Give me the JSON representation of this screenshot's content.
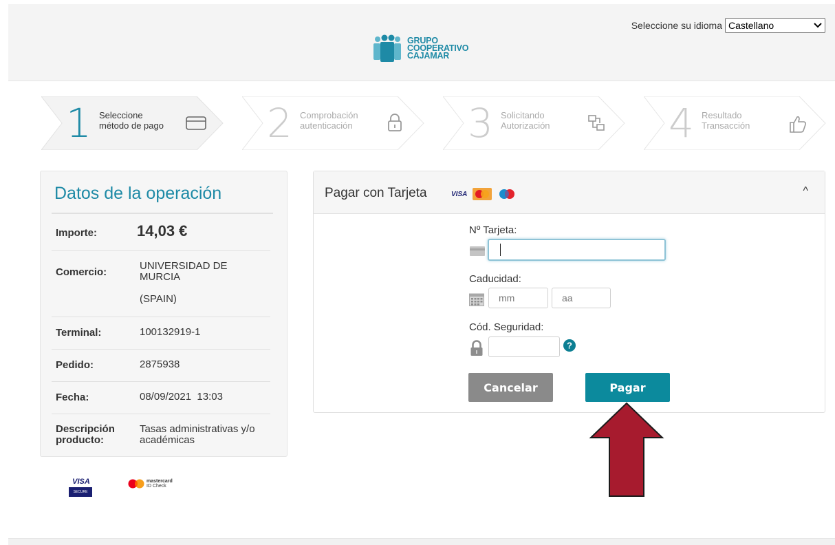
{
  "header": {
    "logo_lines": [
      "GRUPO",
      "COOPERATIVO",
      "CAJAMAR"
    ],
    "language_label": "Seleccione su idioma",
    "language_selected": "Castellano"
  },
  "steps": [
    {
      "number": "1",
      "line1": "Seleccione",
      "line2": "método de pago",
      "icon": "credit-card-icon",
      "state": "active"
    },
    {
      "number": "2",
      "line1": "Comprobación",
      "line2": "autenticación",
      "icon": "lock-icon",
      "state": "inactive"
    },
    {
      "number": "3",
      "line1": "Solicitando",
      "line2": "Autorización",
      "icon": "authorization-icon",
      "state": "inactive"
    },
    {
      "number": "4",
      "line1": "Resultado",
      "line2": "Transacción",
      "icon": "thumbs-up-icon",
      "state": "inactive"
    }
  ],
  "operation": {
    "title": "Datos de la operación",
    "amount_label": "Importe:",
    "amount_value": "14,03 €",
    "merchant_label": "Comercio:",
    "merchant_line1": "UNIVERSIDAD DE",
    "merchant_line2": "MURCIA",
    "merchant_line3": "(SPAIN)",
    "terminal_label": "Terminal:",
    "terminal_value": "100132919-1",
    "order_label": "Pedido:",
    "order_value": "2875938",
    "date_label": "Fecha:",
    "date_value": "08/09/2021  13:03",
    "desc_label_1": "Descripción",
    "desc_label_2": "producto:",
    "desc_value_1": "Tasas administrativas y/o",
    "desc_value_2": "académicas"
  },
  "badges": {
    "visa_text": "VISA",
    "visa_sub": "SECURE",
    "mc_line1": "mastercard",
    "mc_line2": "ID Check"
  },
  "card": {
    "title": "Pagar con Tarjeta",
    "visa_logo": "VISA",
    "collapse_glyph": "^",
    "card_number_label": "Nº Tarjeta:",
    "expiry_label": "Caducidad:",
    "month_placeholder": "mm",
    "year_placeholder": "aa",
    "cvv_label": "Cód. Seguridad:",
    "cancel_label": "Cancelar",
    "pay_label": "Pagar"
  },
  "colors": {
    "accent": "#1e8aa6",
    "pay_button": "#0c8a9d",
    "cancel_button": "#8a8a8a",
    "arrow": "#a71b2e"
  }
}
